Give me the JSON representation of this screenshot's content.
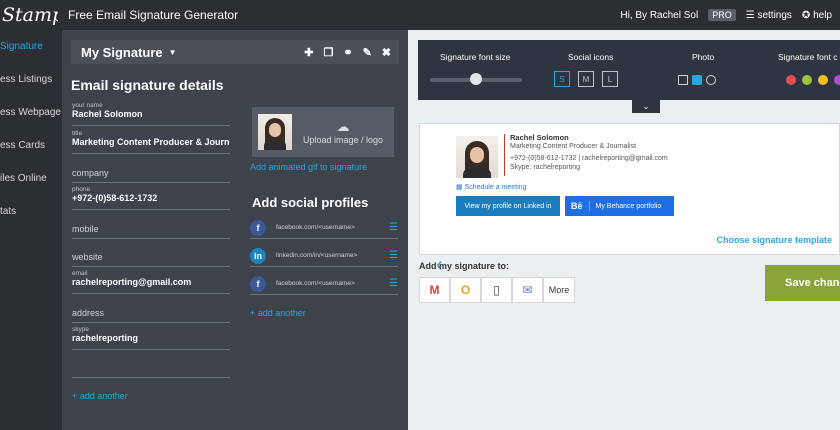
{
  "app": {
    "logo": "Stamp",
    "title": "Free Email Signature Generator"
  },
  "topbar": {
    "greeting": "Hi, By Rachel Sol",
    "pro": "PRO",
    "settings": "☰ settings",
    "help": "✪ help"
  },
  "sidebar": {
    "items": [
      {
        "label": "Signature",
        "active": true
      },
      {
        "label": "ess Listings",
        "active": false
      },
      {
        "label": "ess Webpage",
        "active": false
      },
      {
        "label": "ess Cards",
        "active": false
      },
      {
        "label": "iles Online",
        "active": false
      },
      {
        "label": "tats",
        "active": false
      }
    ]
  },
  "editor": {
    "dropdown": "My Signature",
    "section_title": "Email signature details",
    "fields": [
      {
        "label": "your name",
        "value": "Rachel Solomon",
        "placeholder": ""
      },
      {
        "label": "title",
        "value": "Marketing Content Producer & Journ",
        "placeholder": ""
      },
      {
        "label": "",
        "value": "",
        "placeholder": "company"
      },
      {
        "label": "phone",
        "value": "+972-(0)58-612-1732",
        "placeholder": ""
      },
      {
        "label": "",
        "value": "",
        "placeholder": "mobile"
      },
      {
        "label": "",
        "value": "",
        "placeholder": "website"
      },
      {
        "label": "email",
        "value": "rachelreporting@gmail.com",
        "placeholder": ""
      },
      {
        "label": "",
        "value": "",
        "placeholder": "address"
      },
      {
        "label": "skype",
        "value": "rachelreporting",
        "placeholder": ""
      }
    ],
    "add_another_field": "+ add another",
    "upload_label": "Upload image / logo",
    "animated_gif_link": "Add animated gif to signature",
    "social_title": "Add social profiles",
    "social": [
      {
        "icon": "f",
        "text": "facebook.com/<username>",
        "color": "#3b5998"
      },
      {
        "icon": "in",
        "text": "linkedin.com/in/<username>",
        "color": "#1a84bc"
      },
      {
        "icon": "f",
        "text": "facebook.com/<username>",
        "color": "#3b5998"
      }
    ],
    "add_another_social": "+ add another"
  },
  "options": {
    "font_size_label": "Signature font size",
    "social_icons_label": "Social icons",
    "sizes": [
      "S",
      "M",
      "L"
    ],
    "photo_label": "Photo",
    "font_color_label": "Signature font c",
    "colors": [
      "#e84c55",
      "#9bc33a",
      "#f2c01e",
      "#b74fd6"
    ]
  },
  "signature": {
    "name": "Rachel Solomon",
    "title": "Marketing Content Producer & Journalist",
    "contact": "+972-(0)58-612-1732 | rachelreporting@gmail.com",
    "skype": "Skype: rachelreporting",
    "schedule": "Schedule a meeting",
    "linkedin_button": "View my profile on Linked in",
    "behance_icon": "Bē",
    "behance_button": "My Behance portfolio"
  },
  "choose_template": "Choose signature template",
  "add_to": {
    "label": "Add my signature to:",
    "more": "More"
  },
  "save_button": "Save chang",
  "brand_accent": "#29a8e0"
}
